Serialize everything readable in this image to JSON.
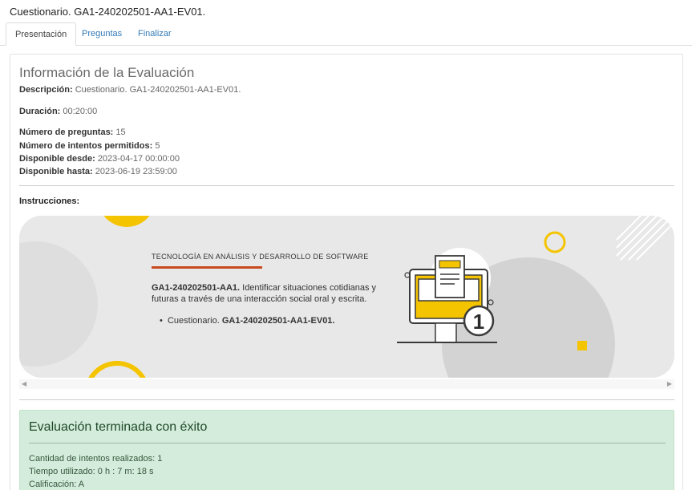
{
  "window": {
    "title": "Cuestionario. GA1-240202501-AA1-EV01."
  },
  "tabs": [
    {
      "label": "Presentación",
      "active": true
    },
    {
      "label": "Preguntas",
      "active": false
    },
    {
      "label": "Finalizar",
      "active": false
    }
  ],
  "info": {
    "title": "Información de la Evaluación",
    "descripcion_label": "Descripción:",
    "descripcion_value": "Cuestionario. GA1-240202501-AA1-EV01.",
    "duracion_label": "Duración:",
    "duracion_value": "00:20:00",
    "preguntas_label": "Número de preguntas:",
    "preguntas_value": "15",
    "intentos_label": "Número de intentos permitidos:",
    "intentos_value": "5",
    "desde_label": "Disponible desde:",
    "desde_value": "2023-04-17 00:00:00",
    "hasta_label": "Disponible hasta:",
    "hasta_value": "2023-06-19 23:59:00"
  },
  "instructions": {
    "label": "Instrucciones:",
    "heading": "TECNOLOGÍA EN ANÁLISIS Y DESARROLLO DE SOFTWARE",
    "code": "GA1-240202501-AA1.",
    "description": " Identificar situaciones cotidianas y futuras a través de una interacción social oral y escrita.",
    "list_prefix": "Cuestionario. ",
    "list_code": "GA1-240202501-AA1-EV01.",
    "badge_number": "1"
  },
  "result": {
    "title": "Evaluación terminada con éxito",
    "intentos": "Cantidad de intentos realizados: 1",
    "tiempo": "Tiempo utilizado: 0 h : 7 m: 18 s",
    "calificacion": "Calificación: A"
  },
  "colors": {
    "accent_yellow": "#f5c400",
    "rule_orange": "#c94a1f",
    "success_bg": "#d4ecdb",
    "link_blue": "#337ab7"
  }
}
